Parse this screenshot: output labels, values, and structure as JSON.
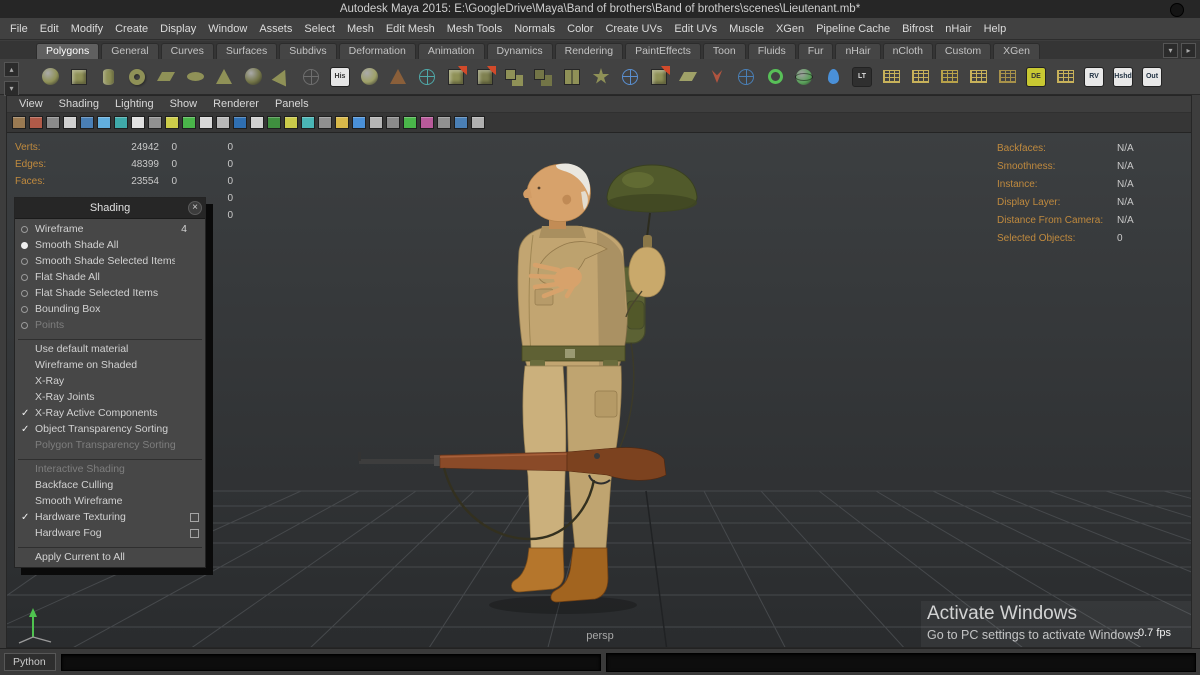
{
  "title_bar": {
    "title": "Autodesk Maya 2015: E:\\GoogleDrive\\Maya\\Band of brothers\\Band of brothers\\scenes\\Lieutenant.mb*"
  },
  "icons": {
    "chevron_down": "▾",
    "chevron_right": "▸",
    "chevron_up": "▴",
    "close": "×"
  },
  "menu_bar": {
    "items": [
      "File",
      "Edit",
      "Modify",
      "Create",
      "Display",
      "Window",
      "Assets",
      "Select",
      "Mesh",
      "Edit Mesh",
      "Mesh Tools",
      "Normals",
      "Color",
      "Create UVs",
      "Edit UVs",
      "Muscle",
      "XGen",
      "Pipeline Cache",
      "Bifrost",
      "nHair",
      "Help"
    ]
  },
  "shelf": {
    "tabs": [
      {
        "label": "Polygons",
        "cls": "active"
      },
      {
        "label": "General"
      },
      {
        "label": "Curves"
      },
      {
        "label": "Surfaces"
      },
      {
        "label": "Subdivs"
      },
      {
        "label": "Deformation"
      },
      {
        "label": "Animation"
      },
      {
        "label": "Dynamics"
      },
      {
        "label": "Rendering"
      },
      {
        "label": "PaintEffects"
      },
      {
        "label": "Toon"
      },
      {
        "label": "Fluids"
      },
      {
        "label": "Fur"
      },
      {
        "label": "nHair"
      },
      {
        "label": "nCloth"
      },
      {
        "label": "Custom"
      },
      {
        "label": "XGen"
      }
    ],
    "icons": [
      {
        "shape": "sphere",
        "color": "#8f9157"
      },
      {
        "shape": "cube",
        "color": "#8f9157"
      },
      {
        "shape": "cylinder",
        "color": "#8f9157"
      },
      {
        "shape": "torus",
        "color": "#8f9157"
      },
      {
        "shape": "plane",
        "color": "#8f9157"
      },
      {
        "shape": "disc",
        "color": "#8f9157"
      },
      {
        "shape": "cone",
        "color": "#8f9157"
      },
      {
        "shape": "sphere",
        "color": "#737547"
      },
      {
        "shape": "wedge",
        "color": "#8f9157"
      },
      {
        "shape": "wire",
        "color": "#6e6e6e"
      },
      {
        "shape": "label",
        "color": "#e6e6e6",
        "label": "His",
        "text_color": "#333333"
      },
      {
        "shape": "sphere",
        "color": "#9fa168"
      },
      {
        "shape": "cone",
        "color": "#8a5f3a"
      },
      {
        "shape": "wire",
        "color": "#4fa8a8"
      },
      {
        "shape": "cube-red",
        "color": "#8f9157"
      },
      {
        "shape": "cube-red",
        "color": "#7f8150"
      },
      {
        "shape": "cubes",
        "color": "#8f9157"
      },
      {
        "shape": "cubes",
        "color": "#737547"
      },
      {
        "shape": "cube-split",
        "color": "#8f9157"
      },
      {
        "shape": "spike",
        "color": "#8f9157"
      },
      {
        "shape": "wire",
        "color": "#5a8fd0"
      },
      {
        "shape": "cube-red",
        "color": "#8f9157"
      },
      {
        "shape": "plane",
        "color": "#9fa168"
      },
      {
        "shape": "crack",
        "color": "#b0543f"
      },
      {
        "shape": "wire",
        "color": "#4a7fb5"
      },
      {
        "shape": "ring",
        "color": "#58c058"
      },
      {
        "shape": "globe",
        "color": "#58a058"
      },
      {
        "shape": "drop",
        "color": "#4a90d8"
      },
      {
        "shape": "label",
        "color": "#2f2f2f",
        "label": "LT",
        "text_color": "#dddddd"
      },
      {
        "shape": "grid",
        "color": "#c8b25a"
      },
      {
        "shape": "grid",
        "color": "#c8b25a"
      },
      {
        "shape": "grid",
        "color": "#b8a24a"
      },
      {
        "shape": "grid",
        "color": "#c8b25a"
      },
      {
        "shape": "grid",
        "color": "#a8924a"
      },
      {
        "shape": "label",
        "color": "#c8c832",
        "label": "DE",
        "text_color": "#333333"
      },
      {
        "shape": "grid",
        "color": "#c8b25a"
      },
      {
        "shape": "label",
        "color": "#e8e8e8",
        "label": "RV",
        "text_color": "#223344"
      },
      {
        "shape": "label",
        "color": "#e8e8e8",
        "label": "Hshd",
        "text_color": "#223344"
      },
      {
        "shape": "label",
        "color": "#e8e8e8",
        "label": "Out",
        "text_color": "#223344"
      }
    ]
  },
  "panel_menu": {
    "items": [
      "View",
      "Shading",
      "Lighting",
      "Show",
      "Renderer",
      "Panels"
    ]
  },
  "panel_toolbar": {
    "icons": [
      "#9a7a52",
      "#b05a48",
      "#8a8a8a",
      "#d0d0d0",
      "#4a7fb5",
      "#62aede",
      "#3fa9a9",
      "#e0e0e0",
      "#909090",
      "#cccc4a",
      "#4ab54a",
      "#d8d8d8",
      "#b8b8b8",
      "#2f6fb2",
      "#d0d0d0",
      "#3f8f3f",
      "#caca4a",
      "#4ab5b5",
      "#8f8f8f",
      "#d8b84a",
      "#4a90d8",
      "#b5b5b5",
      "#8a8a8a",
      "#4ab54a",
      "#b85a9a",
      "#909090",
      "#4a7fb5",
      "#b0b0b0"
    ]
  },
  "hud": {
    "left_rows": [
      {
        "label": "Verts:",
        "total": "24942",
        "selected": "0",
        "other": "0"
      },
      {
        "label": "Edges:",
        "total": "48399",
        "selected": "0",
        "other": "0"
      },
      {
        "label": "Faces:",
        "total": "23554",
        "selected": "0",
        "other": "0"
      },
      {
        "label": "",
        "total": "",
        "selected": "",
        "other": "0"
      },
      {
        "label": "",
        "total": "",
        "selected": "",
        "other": "0"
      }
    ],
    "right_rows": [
      {
        "label": "Backfaces:",
        "value": "N/A"
      },
      {
        "label": "Smoothness:",
        "value": "N/A"
      },
      {
        "label": "Instance:",
        "value": "N/A"
      },
      {
        "label": "Display Layer:",
        "value": "N/A"
      },
      {
        "label": "Distance From Camera:",
        "value": "N/A"
      },
      {
        "label": "Selected Objects:",
        "value": "0"
      }
    ]
  },
  "shading_menu": {
    "title": "Shading",
    "items": [
      {
        "label": "Wireframe",
        "cls": "radio",
        "hotkey": "4",
        "inter": "true"
      },
      {
        "label": "Smooth Shade All",
        "cls": "radio on",
        "inter": "true"
      },
      {
        "label": "Smooth Shade Selected Items",
        "cls": "radio",
        "inter": "true"
      },
      {
        "label": "Flat Shade All",
        "cls": "radio",
        "inter": "true"
      },
      {
        "label": "Flat Shade Selected Items",
        "cls": "radio",
        "inter": "true"
      },
      {
        "label": "Bounding Box",
        "cls": "radio",
        "inter": "true"
      },
      {
        "label": "Points",
        "cls": "radio disabled",
        "inter": "false"
      },
      {
        "cls": "sep",
        "inter": "false"
      },
      {
        "label": "Use default material",
        "cls": "check",
        "inter": "true"
      },
      {
        "label": "Wireframe on Shaded",
        "cls": "check",
        "inter": "true"
      },
      {
        "label": "X-Ray",
        "cls": "check",
        "inter": "true"
      },
      {
        "label": "X-Ray Joints",
        "cls": "check",
        "inter": "true"
      },
      {
        "label": "X-Ray Active Components",
        "cls": "check on",
        "inter": "true"
      },
      {
        "label": "Object Transparency Sorting",
        "cls": "check on",
        "inter": "true"
      },
      {
        "label": "Polygon Transparency Sorting",
        "cls": "check disabled",
        "inter": "false"
      },
      {
        "cls": "sep",
        "inter": "false"
      },
      {
        "label": "Interactive Shading",
        "cls": "check disabled",
        "inter": "false"
      },
      {
        "label": "Backface Culling",
        "cls": "check",
        "inter": "true"
      },
      {
        "label": "Smooth Wireframe",
        "cls": "check",
        "inter": "true"
      },
      {
        "label": "Hardware Texturing",
        "cls": "check on",
        "optcls": "box",
        "inter": "true"
      },
      {
        "label": "Hardware Fog",
        "cls": "check",
        "optcls": "box",
        "inter": "true"
      },
      {
        "cls": "sep",
        "inter": "false"
      },
      {
        "label": "Apply Current to All",
        "cls": "cmd",
        "inter": "true"
      }
    ]
  },
  "viewport": {
    "camera_label": "persp",
    "fps": "0.7 fps"
  },
  "watermark": {
    "line1": "Activate Windows",
    "line2": "Go to PC settings to activate Windows"
  },
  "command_line": {
    "language": "Python"
  }
}
